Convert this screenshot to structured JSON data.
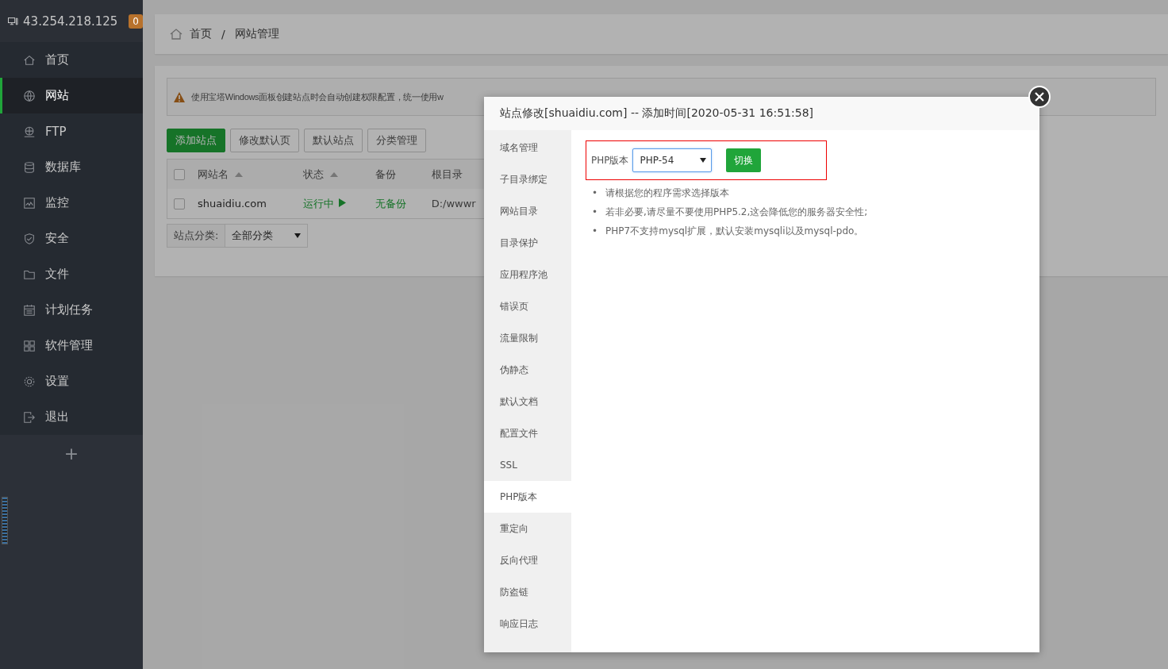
{
  "sidebar": {
    "server_ip": "43.254.218.125",
    "badge": "0",
    "items": [
      {
        "label": "首页",
        "selected": false
      },
      {
        "label": "网站",
        "selected": true
      },
      {
        "label": "FTP",
        "selected": false
      },
      {
        "label": "数据库",
        "selected": false
      },
      {
        "label": "监控",
        "selected": false
      },
      {
        "label": "安全",
        "selected": false
      },
      {
        "label": "文件",
        "selected": false
      },
      {
        "label": "计划任务",
        "selected": false
      },
      {
        "label": "软件管理",
        "selected": false
      },
      {
        "label": "设置",
        "selected": false
      },
      {
        "label": "退出",
        "selected": false
      }
    ],
    "add_button": "+"
  },
  "breadcrumb": {
    "items": [
      "首页",
      "网站管理"
    ],
    "separator": "/"
  },
  "notice": {
    "text": "使用宝塔Windows面板创建站点时会自动创建权限配置，统一使用w"
  },
  "toolbar_buttons": [
    {
      "label": "添加站点",
      "primary": true
    },
    {
      "label": "修改默认页",
      "primary": false
    },
    {
      "label": "默认站点",
      "primary": false
    },
    {
      "label": "分类管理",
      "primary": false
    }
  ],
  "table": {
    "header_checked": false,
    "columns": [
      {
        "label": "网站名",
        "sortable": true
      },
      {
        "label": "状态",
        "sortable": true
      },
      {
        "label": "备份",
        "sortable": false
      },
      {
        "label": "根目录",
        "sortable": false
      }
    ],
    "rows": [
      {
        "checked": false,
        "cells": [
          "shuaidiu.com",
          "运行中",
          "无备份",
          "D:/wwwr"
        ]
      }
    ]
  },
  "category_filter": {
    "label": "站点分类:",
    "value": "全部分类"
  },
  "dialog": {
    "title": "站点修改[shuaidiu.com] -- 添加时间[2020-05-31 16:51:58]",
    "menu": [
      {
        "label": "域名管理",
        "selected": false
      },
      {
        "label": "子目录绑定",
        "selected": false
      },
      {
        "label": "网站目录",
        "selected": false
      },
      {
        "label": "目录保护",
        "selected": false
      },
      {
        "label": "应用程序池",
        "selected": false
      },
      {
        "label": "错误页",
        "selected": false
      },
      {
        "label": "流量限制",
        "selected": false
      },
      {
        "label": "伪静态",
        "selected": false
      },
      {
        "label": "默认文档",
        "selected": false
      },
      {
        "label": "配置文件",
        "selected": false
      },
      {
        "label": "SSL",
        "selected": false
      },
      {
        "label": "PHP版本",
        "selected": true
      },
      {
        "label": "重定向",
        "selected": false
      },
      {
        "label": "反向代理",
        "selected": false
      },
      {
        "label": "防盗链",
        "selected": false
      },
      {
        "label": "响应日志",
        "selected": false
      }
    ],
    "bullet": "•",
    "php_label": "PHP版本",
    "php_version": "PHP-54",
    "switch_button": "切换",
    "tips": [
      "请根据您的程序需求选择版本",
      "若非必要,请尽量不要使用PHP5.2,这会降低您的服务器安全性;",
      "PHP7不支持mysql扩展，默认安装mysqli以及mysql-pdo。"
    ]
  }
}
